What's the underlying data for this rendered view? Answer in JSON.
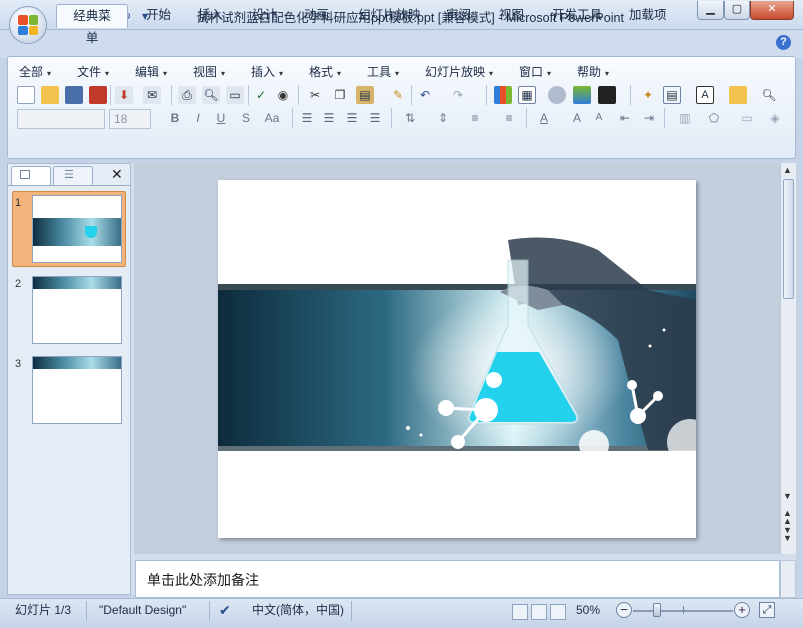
{
  "window": {
    "title": "试杯试剂蓝白配色化学科研应用ppt模板.ppt [兼容模式] - Microsoft PowerPoint",
    "controls": {
      "minimize": "▁",
      "maximize": "▢",
      "close": "✕"
    }
  },
  "quick_access": {
    "save": "💾",
    "undo": "↶",
    "redo": "↻",
    "customize": "▾"
  },
  "ribbon_tabs": [
    "经典菜单",
    "开始",
    "插入",
    "设计",
    "动画",
    "幻灯片放映",
    "审阅",
    "视图",
    "开发工具",
    "加载项"
  ],
  "active_tab": "经典菜单",
  "help_label": "?",
  "menus": [
    "全部",
    "文件",
    "编辑",
    "视图",
    "插入",
    "格式",
    "工具",
    "幻灯片放映",
    "窗口",
    "帮助"
  ],
  "font": {
    "name_placeholder": "",
    "size_placeholder": "18"
  },
  "format_buttons": {
    "bold": "B",
    "italic": "I",
    "underline": "U",
    "shadow": "S",
    "case": "Aa",
    "font_color": "A",
    "grow": "A",
    "shrink": "A",
    "textbox": "A"
  },
  "left_panel": {
    "tab_slides_icon": "slide-thumbnail-icon",
    "tab_outline_icon": "outline-icon",
    "close": "✕",
    "slides": [
      {
        "number": "1",
        "selected": true
      },
      {
        "number": "2",
        "selected": false
      },
      {
        "number": "3",
        "selected": false
      }
    ]
  },
  "notes": {
    "placeholder": "单击此处添加备注"
  },
  "status": {
    "slide_info": "幻灯片 1/3",
    "theme": "\"Default Design\"",
    "language": "中文(简体，中国)",
    "zoom": "50%",
    "zoom_out": "−",
    "zoom_in": "+"
  },
  "colors": {
    "accent_orange": "#f2b47a",
    "slide_band_dark": "#0f2e40",
    "flask_cyan": "#24d1ec",
    "ribbon_blue": "#cfdcee"
  }
}
